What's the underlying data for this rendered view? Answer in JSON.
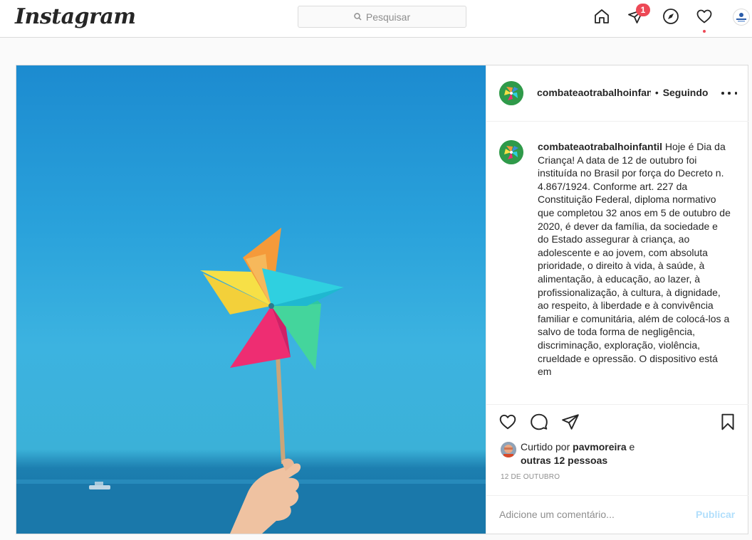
{
  "nav": {
    "logo": "Instagram",
    "search_placeholder": "Pesquisar",
    "notification_count": "1",
    "icons": [
      "home-icon",
      "direct-icon",
      "explore-icon",
      "activity-heart-icon",
      "profile-icon"
    ]
  },
  "post": {
    "header": {
      "username": "combateaotrabalhoinfantil",
      "separator": "•",
      "follow_status": "Seguindo"
    },
    "caption": {
      "username": "combateaotrabalhoinfantil",
      "text": "Hoje é Dia da Criança! A data de 12 de outubro foi instituída no Brasil por força do Decreto n. 4.867/1924. Conforme art. 227 da Constituição Federal, diploma normativo que completou 32 anos em 5 de outubro de 2020, é dever da família, da sociedade e do Estado assegurar à criança, ao adolescente e ao jovem, com absoluta prioridade, o direito à vida, à saúde, à alimentação, à educação, ao lazer, à profissionalização, à cultura, à dignidade, ao respeito, à liberdade e à convivência familiar e comunitária, além de colocá-los a salvo de toda forma de negligência, discriminação, exploração, violência, crueldade e opressão. O dispositivo está em"
    },
    "likes": {
      "prefix": "Curtido por",
      "liker": "pavmoreira",
      "joiner": "e",
      "others": "outras 12 pessoas"
    },
    "date": "12 DE OUTUBRO",
    "comment_placeholder": "Adicione um comentário...",
    "publish_label": "Publicar"
  },
  "colors": {
    "accent": "#0095f6",
    "badge": "#ed4956",
    "publish_disabled": "#b2dffc",
    "border": "#dbdbdb"
  }
}
